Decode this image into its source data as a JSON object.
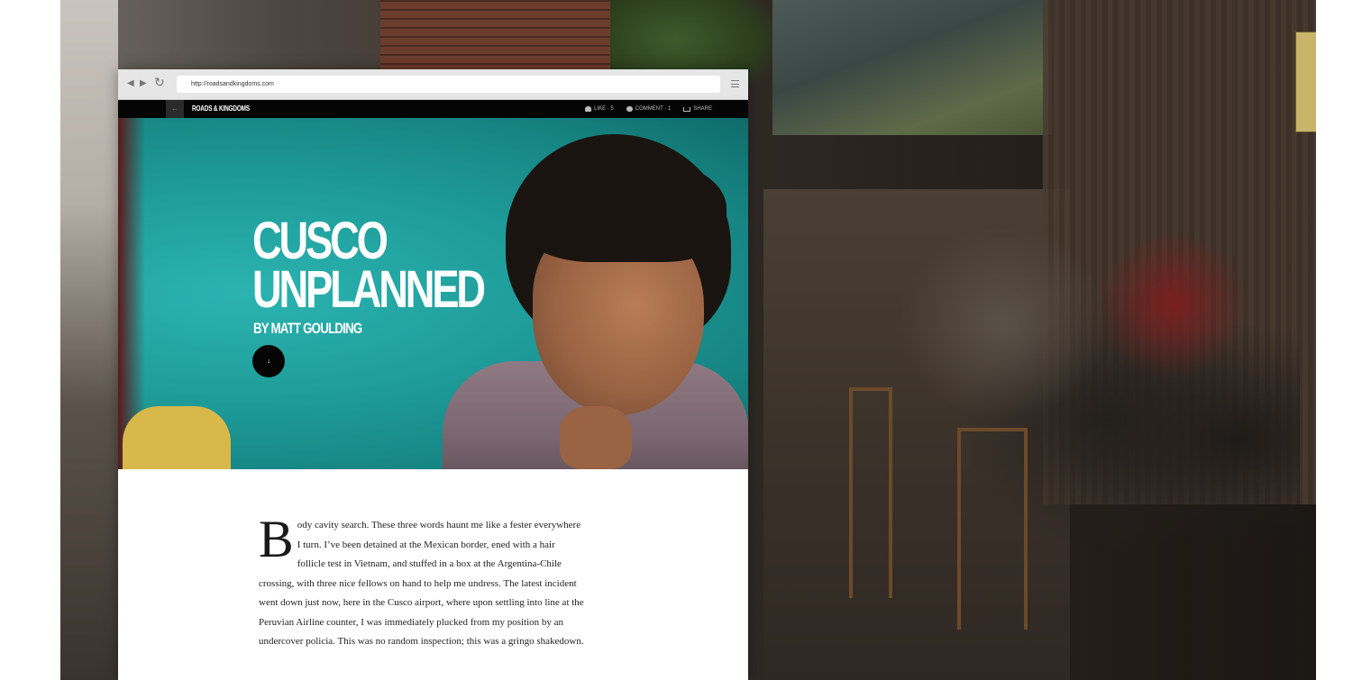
{
  "browser": {
    "url": "http://roadsandkingdoms.com"
  },
  "site": {
    "back_label": "←",
    "logo": "ROADS & KINGDOMS",
    "actions": [
      {
        "label": "LIKE · 5"
      },
      {
        "label": "COMMENT · 1"
      },
      {
        "label": "SHARE"
      }
    ]
  },
  "hero": {
    "title_line1": "CUSCO",
    "title_line2": "UNPLANNED",
    "byline": "BY MATT GOULDING",
    "scroll_icon": "↓"
  },
  "article": {
    "dropcap": "B",
    "body": "ody cavity search. These three words haunt me like a fester everywhere I turn. I’ve been detained at the Mexican border, ened with a hair follicle test in Vietnam, and stuffed in a box at the Argentina-Chile crossing, with three nice fellows on hand to help me undress. The latest incident went down just now, here in the Cusco airport, where upon settling into line at the Peruvian Airline counter, I was immediately plucked from my position by an undercover policia. This was no random inspection; this was a gringo shakedown."
  },
  "colors": {
    "hero_teal": "#1f9e9b",
    "nav_black": "#050505"
  }
}
